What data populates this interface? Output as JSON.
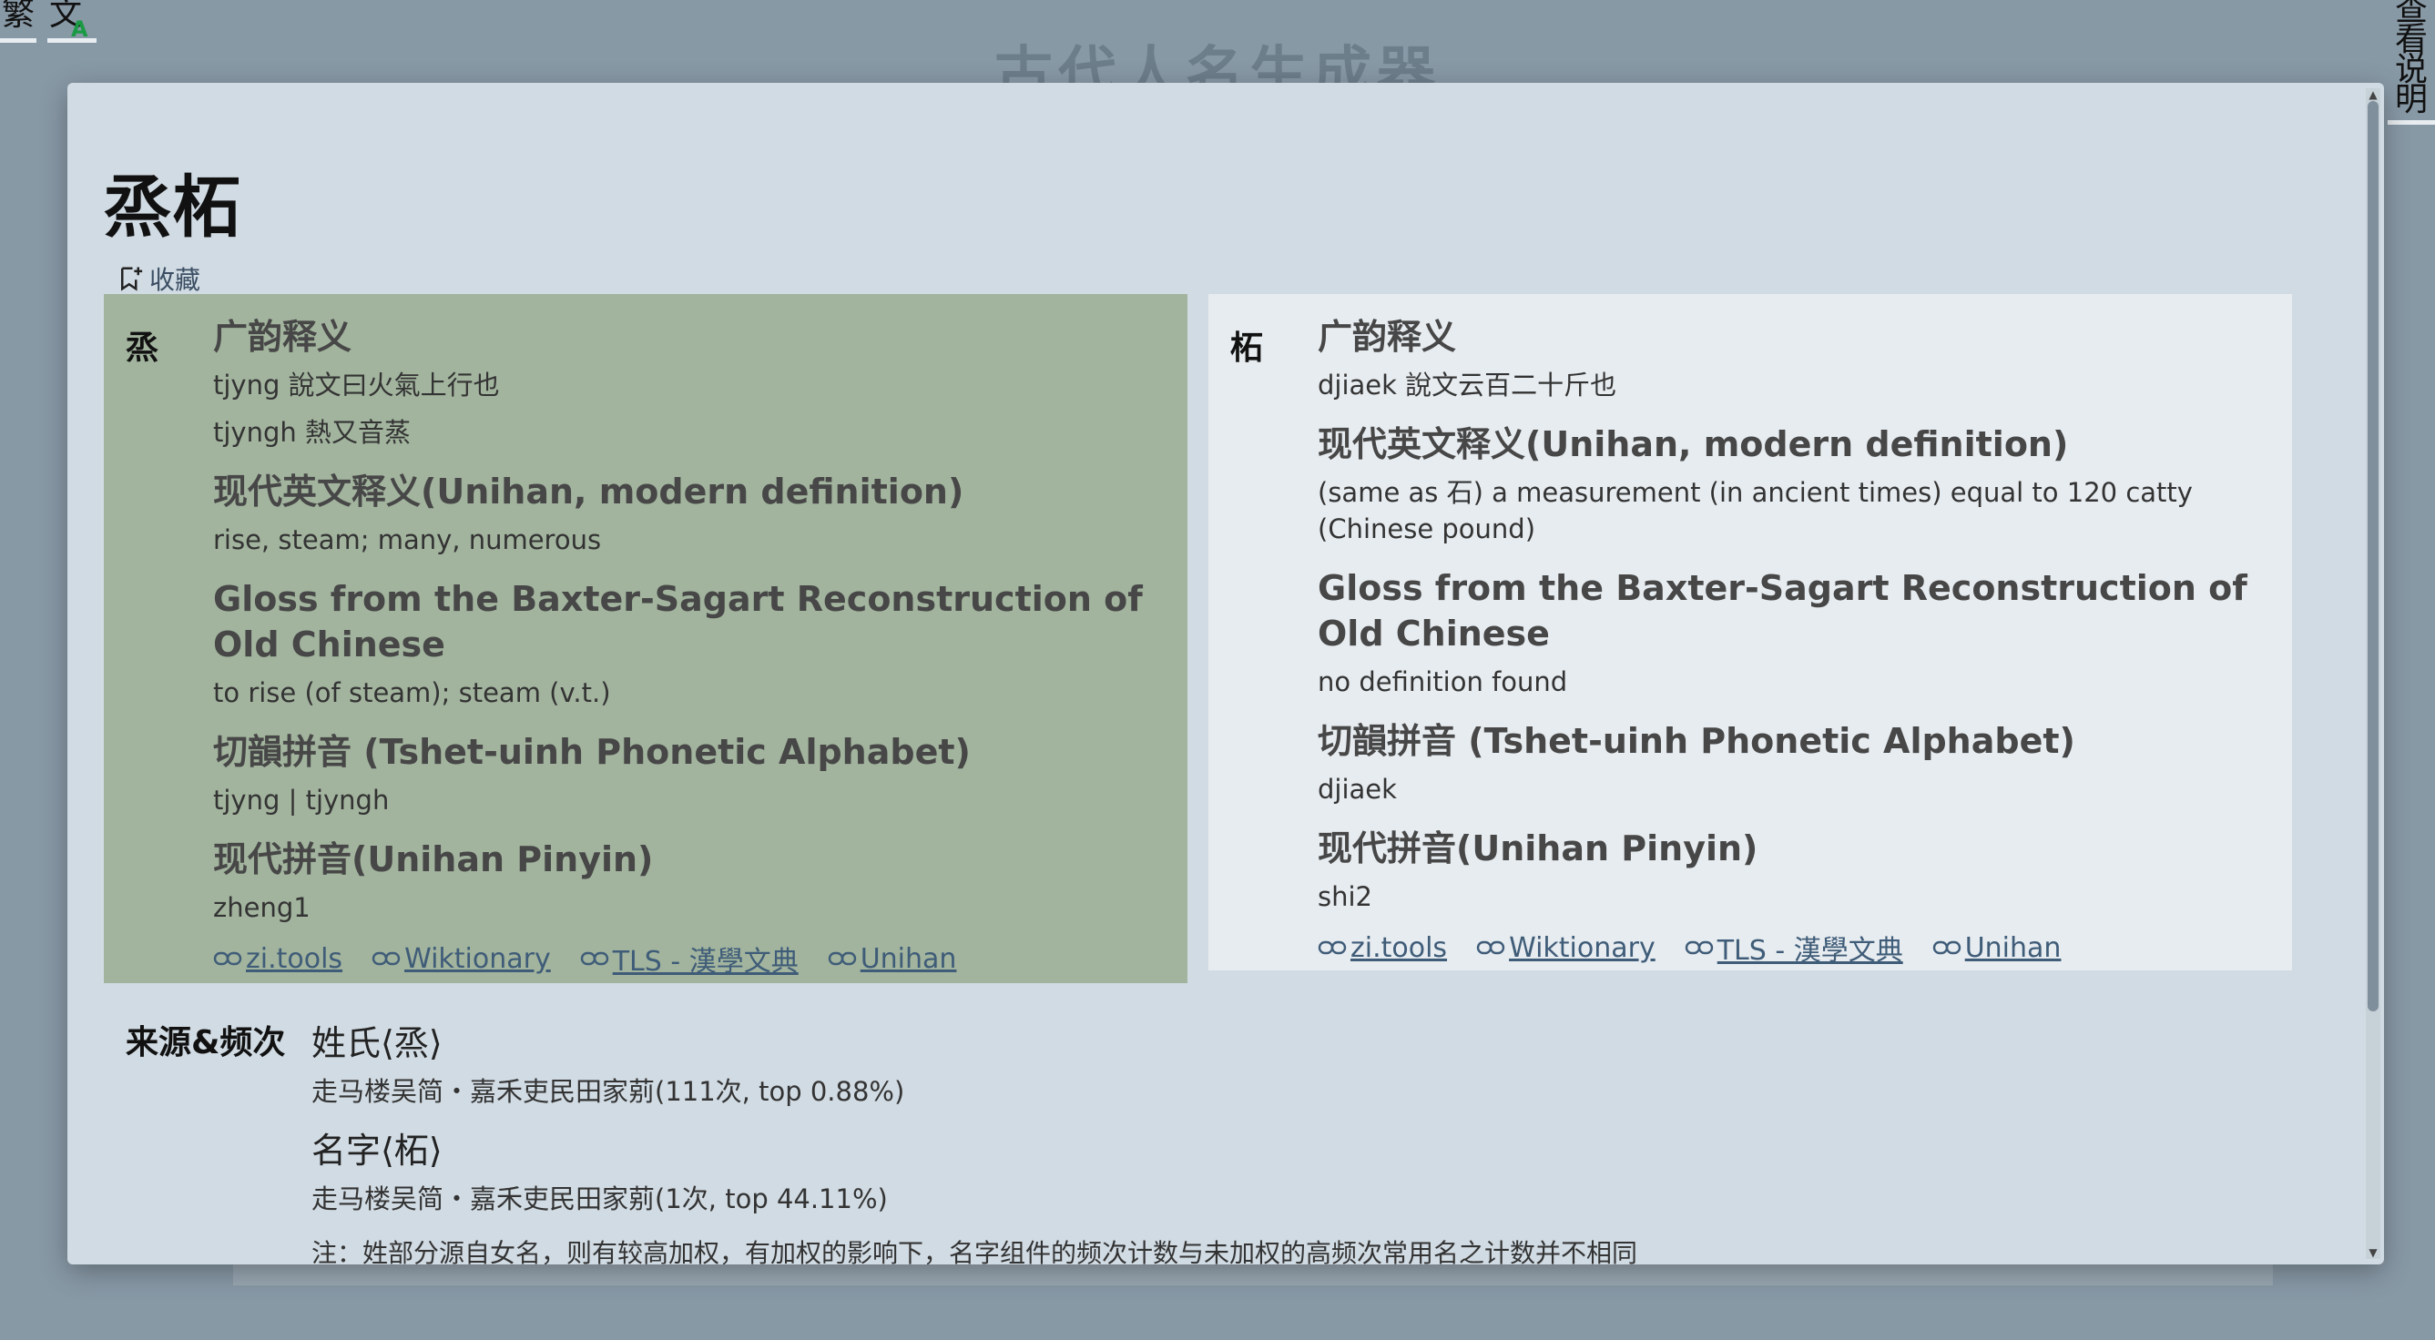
{
  "top": {
    "lang_traditional": "繁",
    "lang_switch_main": "文",
    "lang_switch_sub": "A",
    "bg_title": "古代人名生成器",
    "help_chars": [
      "查",
      "看",
      "说",
      "明"
    ]
  },
  "modal": {
    "title": "烝柘",
    "favorite_label": "收藏",
    "left": {
      "char": "烝",
      "sections": [
        {
          "heading": "广韵释义",
          "lines": [
            "tjyng 說文曰火氣上行也",
            "tjyngh 熱又音蒸"
          ]
        },
        {
          "heading": "现代英文释义(Unihan, modern definition)",
          "lines": [
            "rise, steam; many, numerous"
          ]
        },
        {
          "heading": "Gloss from the Baxter-Sagart Reconstruction of Old Chinese",
          "lines": [
            "to rise (of steam); steam (v.t.)"
          ]
        },
        {
          "heading": "切韻拼音 (Tshet-uinh Phonetic Alphabet)",
          "lines": [
            "tjyng | tjyngh"
          ]
        },
        {
          "heading": "现代拼音(Unihan Pinyin)",
          "lines": [
            "zheng1"
          ]
        }
      ],
      "links": [
        "zi.tools",
        "Wiktionary",
        "TLS - 漢學文典",
        "Unihan"
      ]
    },
    "right": {
      "char": "柘",
      "sections": [
        {
          "heading": "广韵释义",
          "lines": [
            "djiaek 說文云百二十斤也"
          ]
        },
        {
          "heading": "现代英文释义(Unihan, modern definition)",
          "lines": [
            "(same as 石) a measurement (in ancient times) equal to 120 catty (Chinese pound)"
          ]
        },
        {
          "heading": "Gloss from the Baxter-Sagart Reconstruction of Old Chinese",
          "lines": [
            "no definition found"
          ]
        },
        {
          "heading": "切韻拼音 (Tshet-uinh Phonetic Alphabet)",
          "lines": [
            "djiaek"
          ]
        },
        {
          "heading": "现代拼音(Unihan Pinyin)",
          "lines": [
            "shi2"
          ]
        }
      ],
      "links": [
        "zi.tools",
        "Wiktionary",
        "TLS - 漢學文典",
        "Unihan"
      ]
    },
    "source": {
      "label": "来源&频次",
      "surname_heading": "姓氏⟨烝⟩",
      "surname_line": "走马楼吴简・嘉禾吏民田家莂(111次, top 0.88%)",
      "given_heading": "名字⟨柘⟩",
      "given_line": "走马楼吴简・嘉禾吏民田家莂(1次, top 44.11%)",
      "note": "注：姓部分源自女名，则有较高加权，有加权的影响下，名字组件的频次计数与未加权的高频次常用名之计数并不相同"
    }
  }
}
